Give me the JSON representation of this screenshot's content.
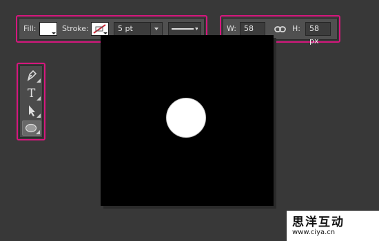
{
  "options_bar": {
    "fill_label": "Fill:",
    "stroke_label": "Stroke:",
    "stroke_width": "5 pt",
    "colors": {
      "fill": "#ffffff",
      "stroke_slash": "#d02a3a"
    }
  },
  "size_bar": {
    "width_label": "W:",
    "width_value": "58 px",
    "height_label": "H:",
    "height_value": "58 px"
  },
  "tools": [
    {
      "name": "pen-icon",
      "active": false
    },
    {
      "name": "type-icon",
      "label": "T",
      "active": false
    },
    {
      "name": "path-selection-icon",
      "active": false
    },
    {
      "name": "ellipse-icon",
      "active": true
    }
  ],
  "canvas": {
    "background": "#000000",
    "shape": "circle",
    "shape_color": "#ffffff"
  },
  "highlight_color": "#d6177e",
  "watermark": {
    "title": "思洋互动",
    "url": "www.ciya.cn"
  }
}
